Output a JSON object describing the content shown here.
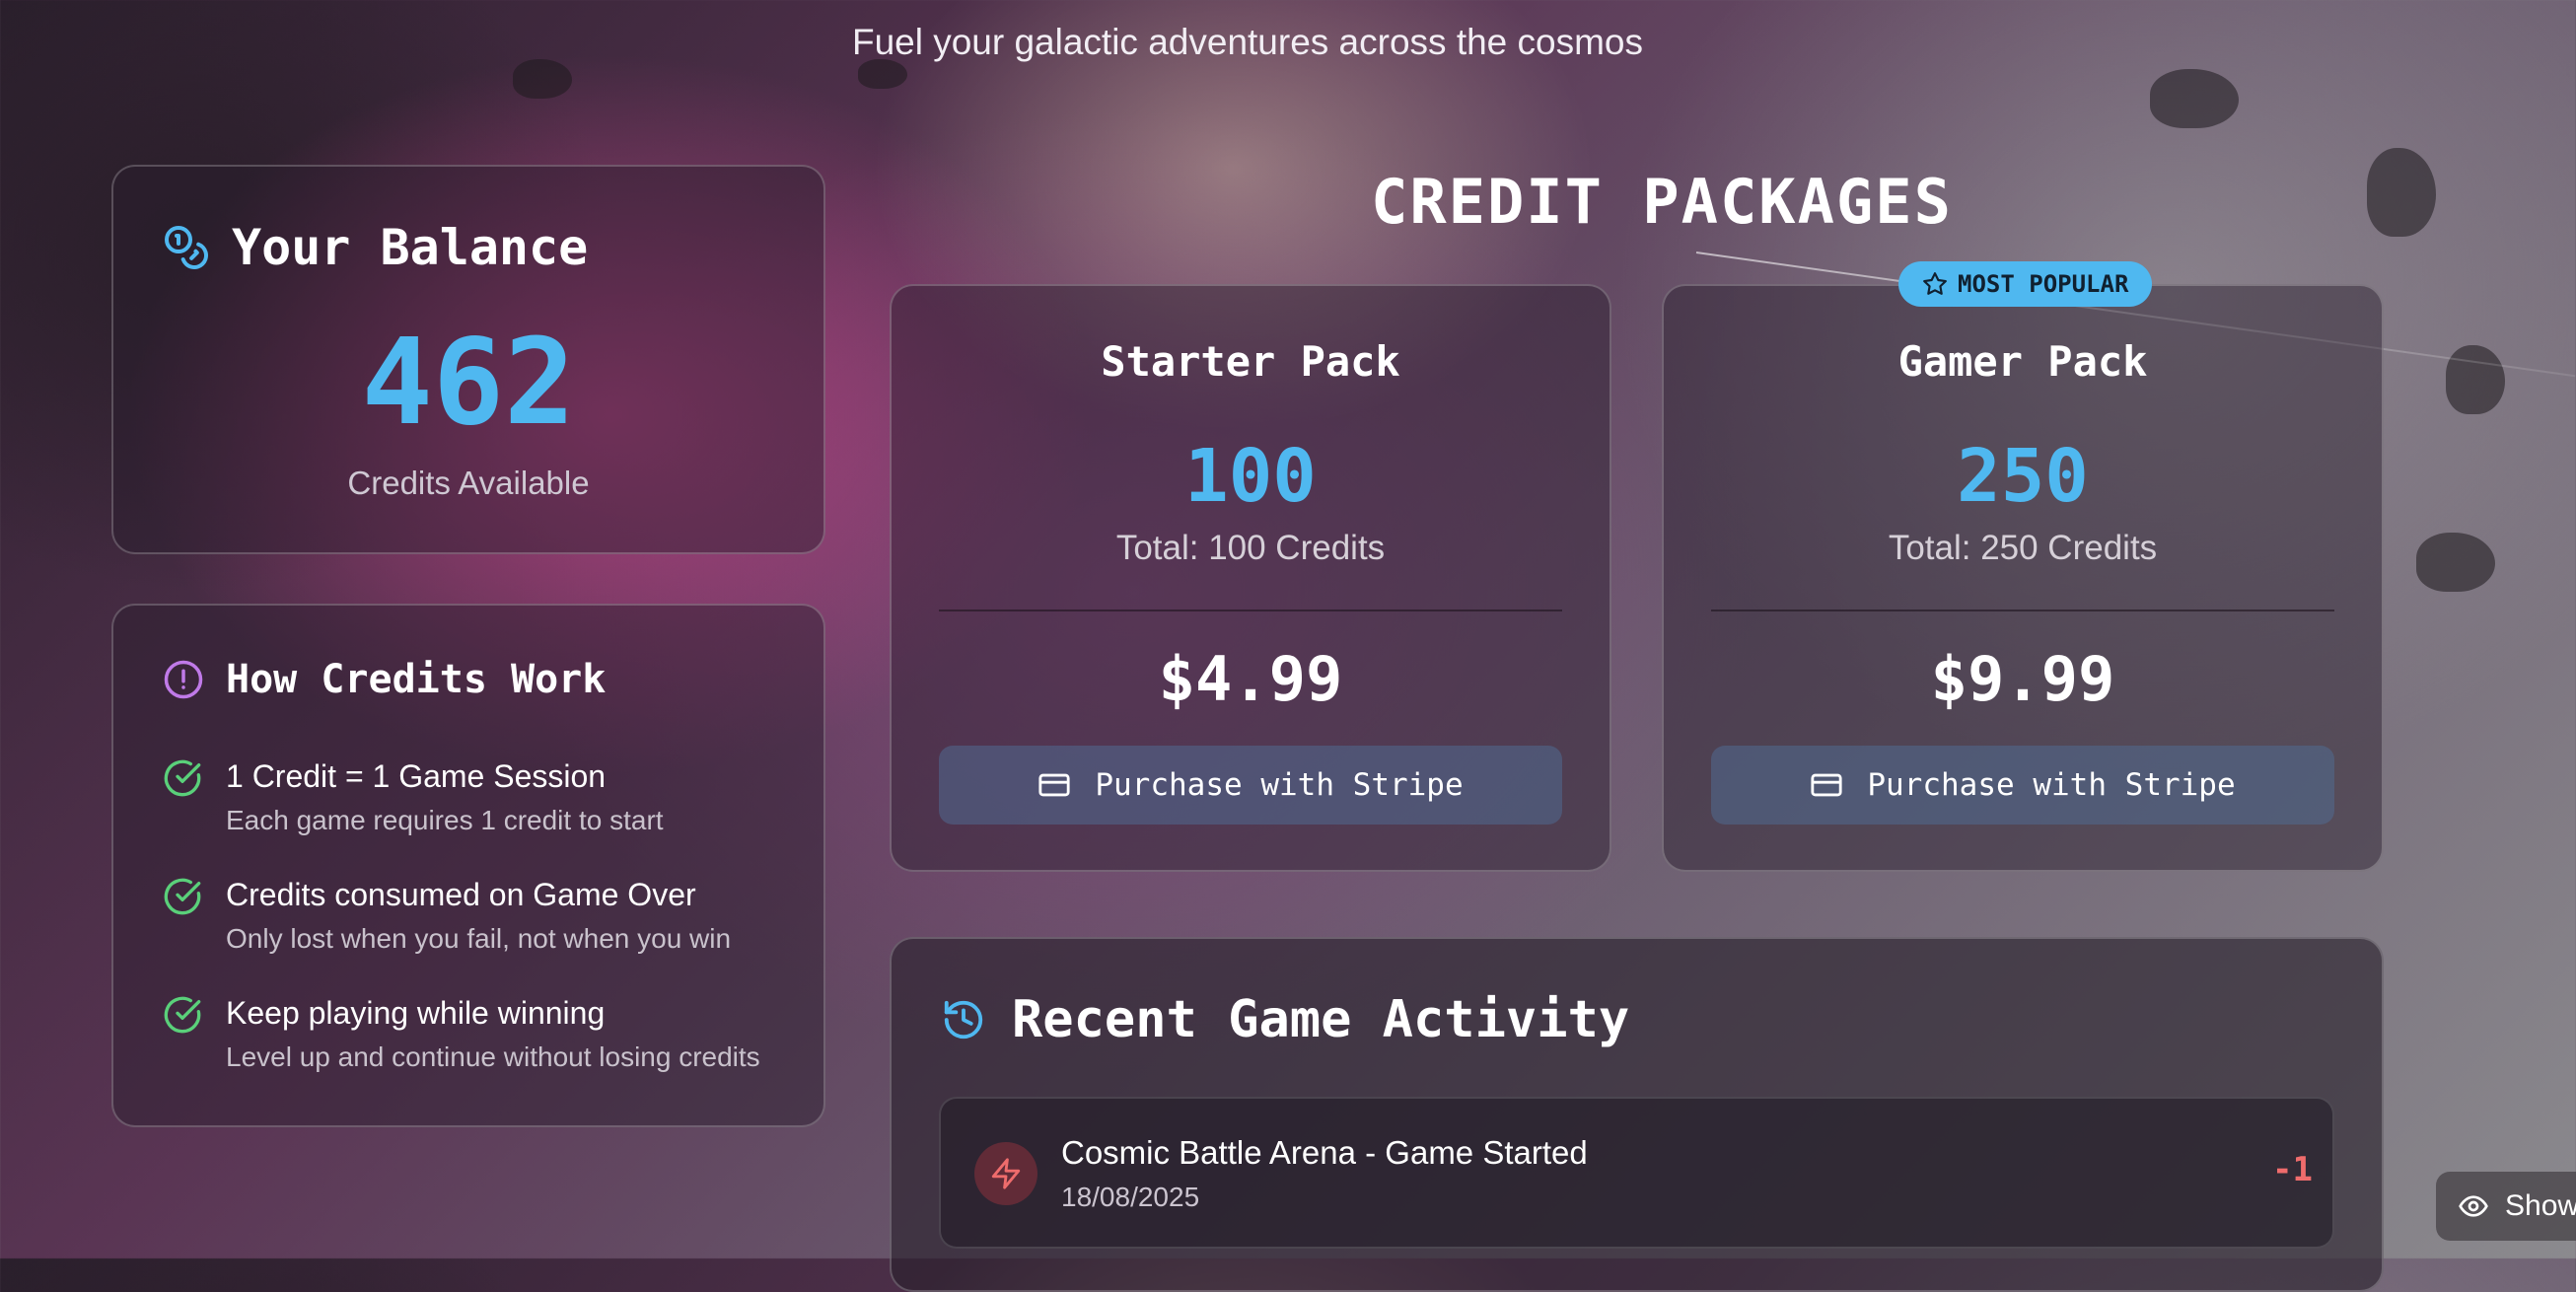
{
  "header": {
    "subtitle": "Fuel your galactic adventures across the cosmos"
  },
  "balance": {
    "title": "Your Balance",
    "amount": "462",
    "label": "Credits Available",
    "icon": "coins-icon"
  },
  "how_credits": {
    "title": "How Credits Work",
    "icon": "alert-circle-icon",
    "items": [
      {
        "title": "1 Credit = 1 Game Session",
        "desc": "Each game requires 1 credit to start"
      },
      {
        "title": "Credits consumed on Game Over",
        "desc": "Only lost when you fail, not when you win"
      },
      {
        "title": "Keep playing while winning",
        "desc": "Level up and continue without losing credits"
      }
    ]
  },
  "packages": {
    "title": "CREDIT PACKAGES",
    "badge": "MOST POPULAR",
    "items": [
      {
        "name": "Starter Pack",
        "credits": "100",
        "total": "Total: 100 Credits",
        "price": "$4.99",
        "button": "Purchase with Stripe"
      },
      {
        "name": "Gamer Pack",
        "credits": "250",
        "total": "Total: 250 Credits",
        "price": "$9.99",
        "button": "Purchase with Stripe"
      }
    ]
  },
  "activity": {
    "title": "Recent Game Activity",
    "rows": [
      {
        "title": "Cosmic Battle Arena - Game Started",
        "date": "18/08/2025",
        "amount": "-1"
      }
    ]
  },
  "floating": {
    "show_label": "Show"
  },
  "colors": {
    "accent": "#4fb8f0",
    "success": "#5ad07a",
    "danger": "#ef6c6c",
    "purple": "#c07ae8"
  }
}
